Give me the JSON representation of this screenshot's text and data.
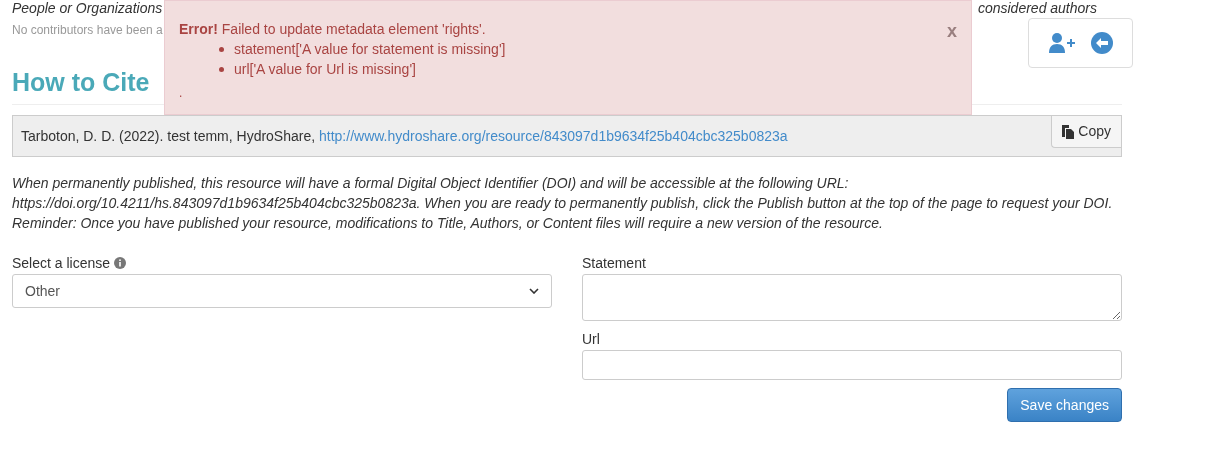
{
  "contributors": {
    "description_start": "People or Organizations",
    "description_end": "considered authors",
    "empty_note": "No contributors have been a"
  },
  "alert": {
    "title": "Error!",
    "message": "Failed to update metadata element 'rights'.",
    "items": [
      "statement['A value for statement is missing']",
      "url['A value for Url is missing']"
    ],
    "trailer": ".",
    "close": "x"
  },
  "cite": {
    "heading": "How to Cite",
    "citation": "Tarboton, D. D. (2022). test temm, HydroShare, ",
    "link": "http://www.hydroshare.org/resource/843097d1b9634f25b404cbc325b0823a",
    "copy_button": "Copy"
  },
  "doi_note": [
    "When permanently published, this resource will have a formal Digital Object Identifier (DOI) and will be accessible at the following URL:",
    "https://doi.org/10.4211/hs.843097d1b9634f25b404cbc325b0823a. When you are ready to permanently publish, click the Publish button at the top of the page to request your DOI.",
    "Reminder: Once you have published your resource, modifications to Title, Authors, or Content files will require a new version of the resource."
  ],
  "license": {
    "label": "Select a license",
    "value": "Other"
  },
  "statement": {
    "label": "Statement"
  },
  "url": {
    "label": "Url"
  },
  "save_button": "Save changes"
}
